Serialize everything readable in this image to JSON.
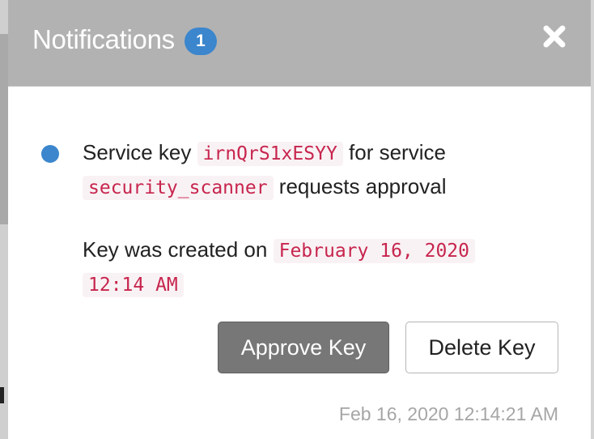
{
  "header": {
    "title": "Notifications",
    "badge_count": "1"
  },
  "notification": {
    "text_part1": "Service key",
    "key_id": "irnQrS1xESYY",
    "text_part2": "for service",
    "service_name": "security_scanner",
    "text_part3": "requests approval",
    "created_prefix": "Key was created on",
    "created_date": "February 16, 2020",
    "created_time": "12:14 AM"
  },
  "actions": {
    "approve_label": "Approve Key",
    "delete_label": "Delete Key"
  },
  "timestamp": "Feb 16, 2020 12:14:21 AM",
  "icons": {
    "close": "close-icon",
    "unread": "unread-dot-icon"
  },
  "colors": {
    "header_bg": "#b2b2b2",
    "badge": "#3b86cd",
    "code_text": "#c7254e",
    "code_bg": "#f9f2f4",
    "approve_bg": "#777777"
  }
}
